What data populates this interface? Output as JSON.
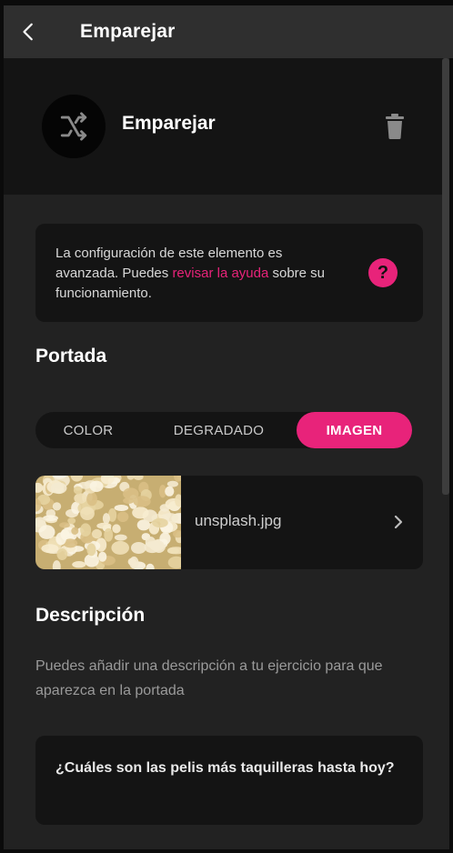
{
  "header": {
    "title": "Emparejar",
    "back_icon": "chevron-left-icon"
  },
  "hero": {
    "title": "Emparejar",
    "icon": "shuffle-icon",
    "delete_icon": "trash-icon"
  },
  "info": {
    "text_before": "La configuración de este elemento es avanzada. Puedes ",
    "link": "revisar la ayuda",
    "text_after": " sobre su funcionamiento.",
    "help_label": "?",
    "accent": "#e8237a"
  },
  "cover": {
    "title": "Portada",
    "tabs": [
      {
        "label": "COLOR",
        "active": false
      },
      {
        "label": "DEGRADADO",
        "active": false
      },
      {
        "label": "IMAGEN",
        "active": true
      }
    ],
    "file": {
      "name": "unsplash.jpg"
    }
  },
  "description": {
    "title": "Descripción",
    "help_text": "Puedes añadir una descripción a tu ejercicio para que aparezca en la portada",
    "value": "¿Cuáles son las pelis más taquilleras hasta hoy?"
  }
}
